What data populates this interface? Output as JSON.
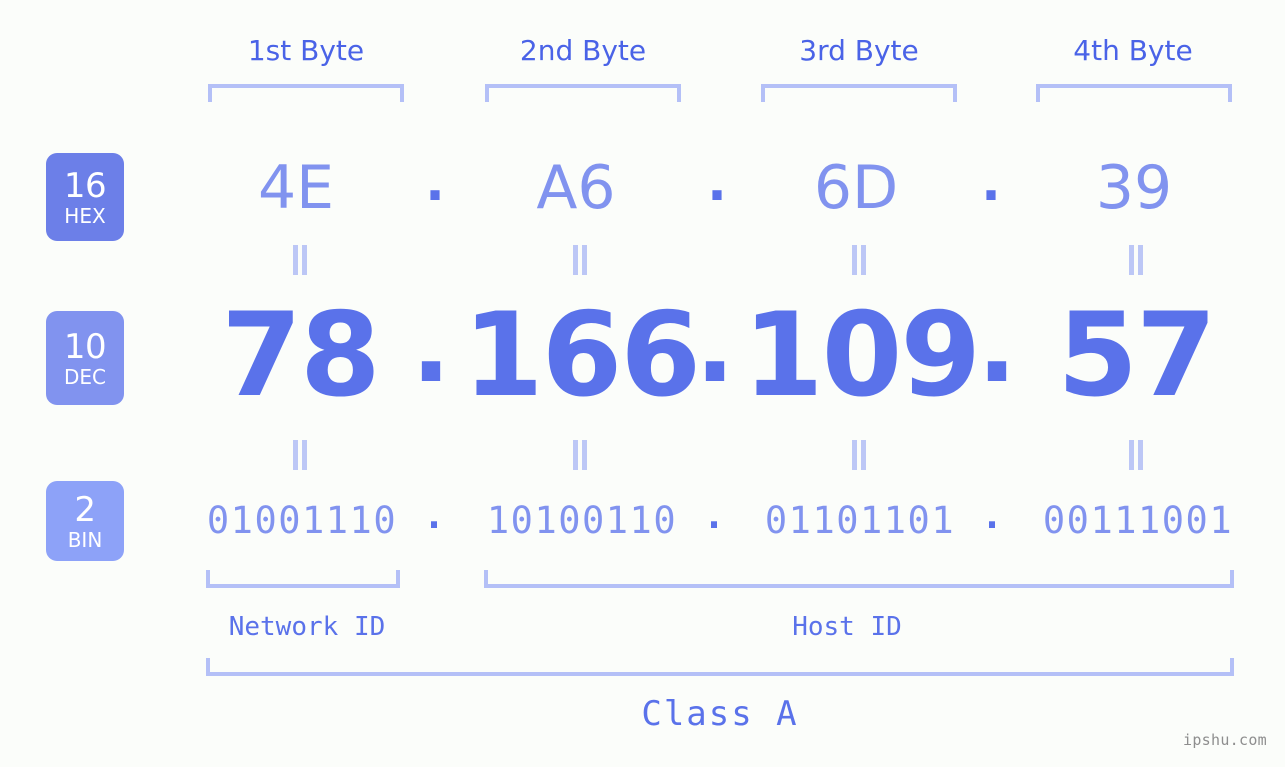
{
  "ip": {
    "dec_address": "78.166.109.57",
    "hex_address": "4E.A6.6D.39",
    "bin_address": "01001110.10100110.01101101.00111001",
    "class": "Class A",
    "separator": "."
  },
  "header": {
    "byte_labels": [
      "1st Byte",
      "2nd Byte",
      "3rd Byte",
      "4th Byte"
    ]
  },
  "bases": [
    {
      "number": "16",
      "name": "HEX",
      "color": "#6c7fe8"
    },
    {
      "number": "10",
      "name": "DEC",
      "color": "#8193ef"
    },
    {
      "number": "2",
      "name": "BIN",
      "color": "#8da2f8"
    }
  ],
  "rows": {
    "hex": {
      "label": "HEX",
      "base": "16",
      "values": [
        "4E",
        "A6",
        "6D",
        "39"
      ]
    },
    "dec": {
      "label": "DEC",
      "base": "10",
      "values": [
        "78",
        "166",
        "109",
        "57"
      ]
    },
    "bin": {
      "label": "BIN",
      "base": "2",
      "values": [
        "01001110",
        "10100110",
        "01101101",
        "00111001"
      ]
    }
  },
  "segments": {
    "network_id": "Network ID",
    "host_id": "Host ID",
    "class_label": "Class A"
  },
  "colors": {
    "background": "#fbfdfa",
    "accent_dark": "#5a72ea",
    "accent_mid": "#4a63e7",
    "accent_light": "#8193ef",
    "bracket": "#b4c0f7",
    "eq_mark": "#bcc7f6",
    "watermark": "#8e8e8e"
  },
  "watermark": "ipshu.com"
}
